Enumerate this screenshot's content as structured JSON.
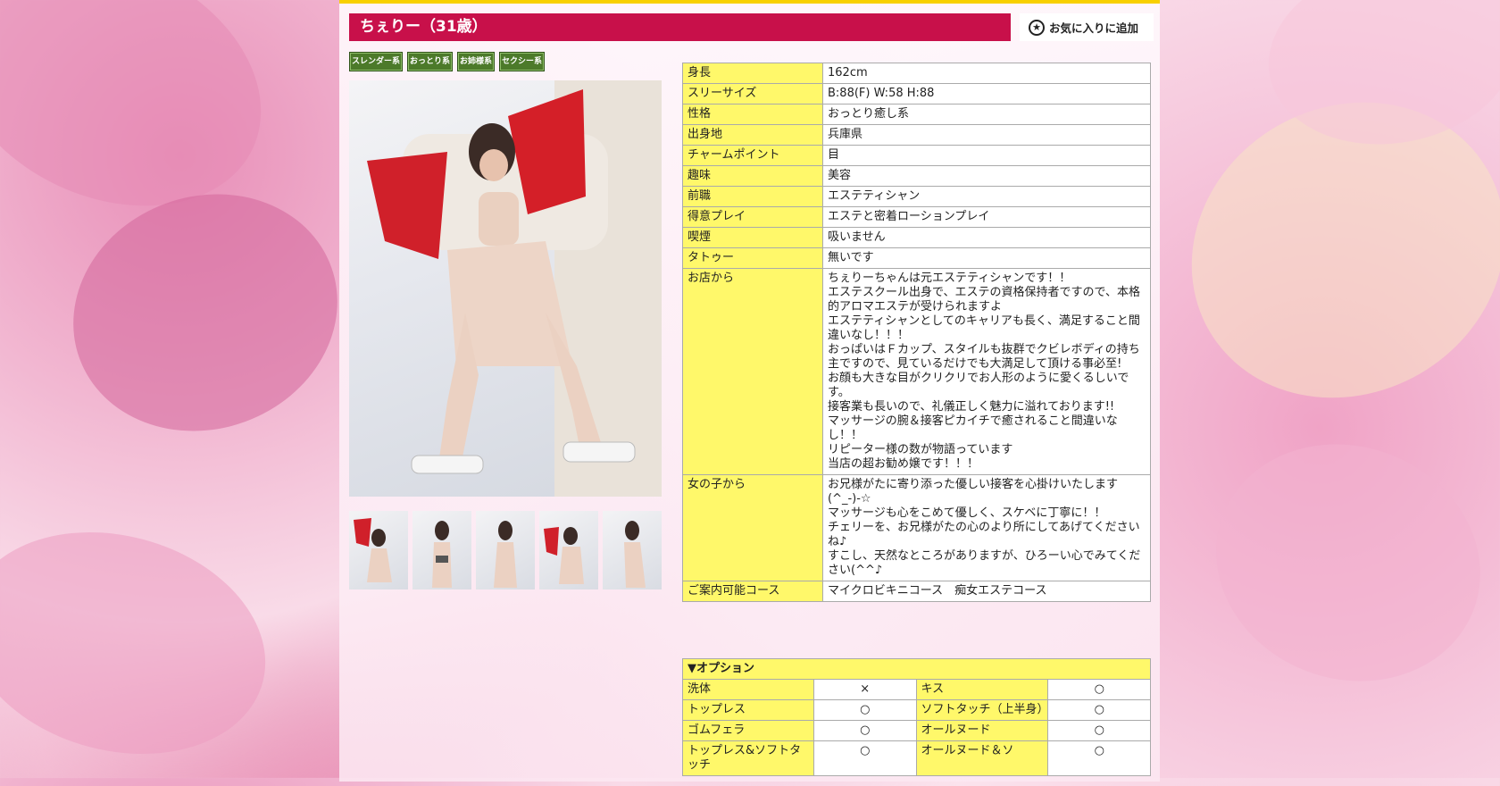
{
  "header": {
    "title": "ちぇりー（31歳）",
    "favorite_label": "お気に入りに追加"
  },
  "tags": [
    "スレンダー系",
    "おっとり系",
    "お姉様系",
    "セクシー系"
  ],
  "profile": [
    {
      "label": "身長",
      "value": "162cm"
    },
    {
      "label": "スリーサイズ",
      "value": "B:88(F) W:58 H:88"
    },
    {
      "label": "性格",
      "value": "おっとり癒し系"
    },
    {
      "label": "出身地",
      "value": "兵庫県"
    },
    {
      "label": "チャームポイント",
      "value": "目"
    },
    {
      "label": "趣味",
      "value": "美容"
    },
    {
      "label": "前職",
      "value": "エステティシャン"
    },
    {
      "label": "得意プレイ",
      "value": "エステと密着ローションプレイ"
    },
    {
      "label": "喫煙",
      "value": "吸いません"
    },
    {
      "label": "タトゥー",
      "value": "無いです"
    },
    {
      "label": "お店から",
      "value": "ちぇりーちゃんは元エステティシャンです！！\nエステスクール出身で、エステの資格保持者ですので、本格的アロマエステが受けられますよ\nエステティシャンとしてのキャリアも長く、満足すること間違いなし！！！\nおっぱいはＦカップ、スタイルも抜群でクビレボディの持ち主ですので、見ているだけでも大満足して頂ける事必至!\nお顔も大きな目がクリクリでお人形のように愛くるしいです。\n接客業も長いので、礼儀正しく魅力に溢れております!!\nマッサージの腕＆接客ピカイチで癒されること間違いなし！！\nリピーター様の数が物語っています\n当店の超お勧め嬢です！！！"
    },
    {
      "label": "女の子から",
      "value": "お兄様がたに寄り添った優しい接客を心掛けいたします(^_-)-☆\nマッサージも心をこめて優しく、スケベに丁寧に！！\nチェリーを、お兄様がたの心のより所にしてあげてくださいね♪\nすこし、天然なところがありますが、ひろーい心でみてください(^^♪"
    },
    {
      "label": "ご案内可能コース",
      "value": "マイクロビキニコース　痴女エステコース"
    }
  ],
  "options": {
    "heading": "▼オプション",
    "rows": [
      [
        {
          "label": "洗体",
          "value": "×"
        },
        {
          "label": "キス",
          "value": "○"
        }
      ],
      [
        {
          "label": "トップレス",
          "value": "○"
        },
        {
          "label": "ソフトタッチ（上半身）",
          "value": "○"
        }
      ],
      [
        {
          "label": "ゴムフェラ",
          "value": "○"
        },
        {
          "label": "オールヌード",
          "value": "○"
        }
      ],
      [
        {
          "label": "トップレス&ソフトタッチ",
          "value": "○"
        },
        {
          "label": "オールヌード＆ソ",
          "value": "○"
        }
      ]
    ]
  },
  "colors": {
    "title_bar": "#c8104a",
    "label_cell": "#fff86a",
    "tag_bg": "#4c7a2a",
    "top_border": "#f8d000"
  }
}
